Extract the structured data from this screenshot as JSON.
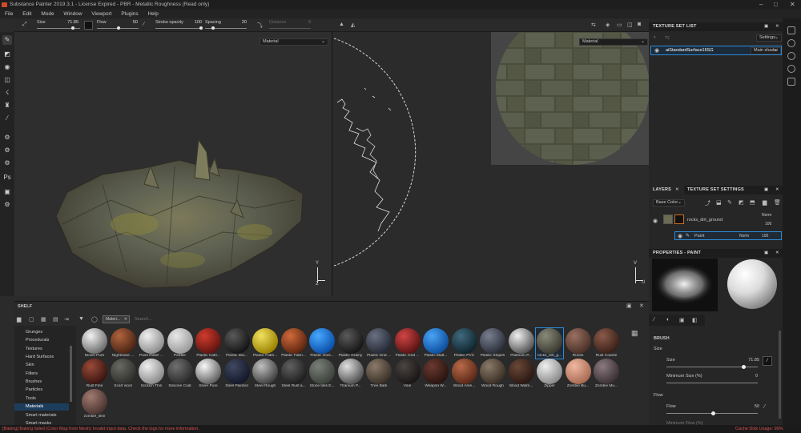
{
  "window": {
    "title": "Substance Painter 2019.3.1 - License Expired - PBR - Metallic Roughness (Read only)"
  },
  "menu": [
    "File",
    "Edit",
    "Mode",
    "Window",
    "Viewport",
    "Plugins",
    "Help"
  ],
  "toolbar": {
    "size_label": "Size",
    "size_value": "71.85",
    "flow_label": "Flow",
    "flow_value": "50",
    "opacity_label": "Stroke opacity",
    "opacity_value": "100",
    "spacing_label": "Spacing",
    "spacing_value": "20",
    "distance_label": "Distance",
    "distance_value": "8"
  },
  "viewport3d": {
    "mode": "Material"
  },
  "viewport2d": {
    "mode": "Material"
  },
  "texture_set_list": {
    "title": "TEXTURE SET LIST",
    "settings": "Settings",
    "item": "aiStandardSurface16SG",
    "shader": "Main shader"
  },
  "layers_panel": {
    "tab_layers": "LAYERS",
    "tab_settings": "TEXTURE SET SETTINGS",
    "channel": "Base Color",
    "layers": [
      {
        "name": "rocks_dirt_ground",
        "blend": "Norm",
        "opacity": "100"
      },
      {
        "name": "Paint",
        "blend": "Norm",
        "opacity": "100"
      }
    ]
  },
  "properties": {
    "title": "PROPERTIES - PAINT",
    "brush_title": "BRUSH",
    "size_section": "Size",
    "size_label": "Size",
    "size_value": "71.85",
    "min_size_label": "Minimum Size (%)",
    "min_size_value": "0",
    "flow_section": "Flow",
    "flow_label": "Flow",
    "flow_value": "50",
    "min_flow_label": "Minimum Flow (%)"
  },
  "shelf": {
    "title": "SHELF",
    "filter": "Materi...",
    "search_placeholder": "Search...",
    "categories": [
      "Grunges",
      "Procedurals",
      "Textures",
      "Hard Surfaces",
      "Skin",
      "Filters",
      "Brushes",
      "Particles",
      "Tools",
      "Materials",
      "Smart materials",
      "Smart masks"
    ],
    "selected_category": "Materials",
    "materials": [
      {
        "name": "Nickel Pure",
        "c1": "#f2f2f2",
        "c2": "#6d6d6d"
      },
      {
        "name": "Nightmare ...",
        "c1": "#b0643e",
        "c2": "#4a2414"
      },
      {
        "name": "Paint Roller ...",
        "c1": "#f0f0f0",
        "c2": "#8d8d8d"
      },
      {
        "name": "Pebble",
        "c1": "#e8e8e8",
        "c2": "#9a9a9a"
      },
      {
        "name": "Plastic Cabl...",
        "c1": "#d03a2c",
        "c2": "#5e1510"
      },
      {
        "name": "Plastic Dia...",
        "c1": "#5a5a5a",
        "c2": "#141414"
      },
      {
        "name": "Plastic Fabri...",
        "c1": "#f3e060",
        "c2": "#9a8300"
      },
      {
        "name": "Plastic Fabri...",
        "c1": "#cf6a3a",
        "c2": "#5e2510"
      },
      {
        "name": "Plastic Glos...",
        "c1": "#47a8ff",
        "c2": "#0a4fa8"
      },
      {
        "name": "Plastic Grainy",
        "c1": "#5a5a5a",
        "c2": "#161616"
      },
      {
        "name": "Plastic Grid ...",
        "c1": "#6a7080",
        "c2": "#252a36"
      },
      {
        "name": "Plastic Grid ...",
        "c1": "#d04545",
        "c2": "#5a1313"
      },
      {
        "name": "Plastic Matt...",
        "c1": "#4aa3f5",
        "c2": "#0d4f9e"
      },
      {
        "name": "Plastic PVC",
        "c1": "#3f6a7e",
        "c2": "#10242d"
      },
      {
        "name": "Plastic Stripes",
        "c1": "#7a8090",
        "c2": "#2a2e3a"
      },
      {
        "name": "Platinum P...",
        "c1": "#f0f0f0",
        "c2": "#555555"
      },
      {
        "name": "rocks_dirt_g...",
        "c1": "#8a8a7a",
        "c2": "#3a3a30"
      },
      {
        "name": "Runes",
        "c1": "#9a7060",
        "c2": "#4a3028"
      },
      {
        "name": "Rust Coarse",
        "c1": "#8a5a4a",
        "c2": "#3a2018"
      },
      {
        "name": "Rust Fine",
        "c1": "#9a4a38",
        "c2": "#3a1510"
      },
      {
        "name": "Scarf wool",
        "c1": "#6a6a64",
        "c2": "#2e2e2a"
      },
      {
        "name": "Scratch Thin",
        "c1": "#f0f0f0",
        "c2": "#8a8a8a"
      },
      {
        "name": "Silicone Coat",
        "c1": "#707070",
        "c2": "#2a2a2a"
      },
      {
        "name": "Silver Pure",
        "c1": "#f8f8f8",
        "c2": "#606060"
      },
      {
        "name": "Steel Painted",
        "c1": "#404860",
        "c2": "#14182a"
      },
      {
        "name": "Steel Rough",
        "c1": "#c0c0c0",
        "c2": "#404040"
      },
      {
        "name": "Steel Rust a...",
        "c1": "#606060",
        "c2": "#1e1e1e"
      },
      {
        "name": "Stone tiles E...",
        "c1": "#7a8078",
        "c2": "#3a403a"
      },
      {
        "name": "Titanium P...",
        "c1": "#e0e0e0",
        "c2": "#505050"
      },
      {
        "name": "Tree Bark",
        "c1": "#8a7a6a",
        "c2": "#3a3028"
      },
      {
        "name": "Vine",
        "c1": "#4a4442",
        "c2": "#1a1616"
      },
      {
        "name": "Weapon W...",
        "c1": "#6a3a30",
        "c2": "#2a1410"
      },
      {
        "name": "Wood Ame...",
        "c1": "#b86a48",
        "c2": "#5a2818"
      },
      {
        "name": "Wood Rough",
        "c1": "#8a7a68",
        "c2": "#3a3026"
      },
      {
        "name": "Wood Walm...",
        "c1": "#6a4838",
        "c2": "#2a1812"
      },
      {
        "name": "Zipper",
        "c1": "#f0f0f0",
        "c2": "#8a8a8a"
      },
      {
        "name": "Zombie Bu...",
        "c1": "#f0b8a0",
        "c2": "#a86a52"
      },
      {
        "name": "Zombie Mu...",
        "c1": "#8a7a80",
        "c2": "#3a3034"
      },
      {
        "name": "zombie_skin",
        "c1": "#a07a70",
        "c2": "#4a3430"
      }
    ]
  },
  "statusbar": {
    "message": "[Baking] Baking failed (Color Map from Mesh) Invalid input data. Check the logs for more information.",
    "disk": "Cache Disk Usage:   99%"
  },
  "colors": {
    "accent": "#2f8ad6",
    "status_error": "#d9534f"
  }
}
